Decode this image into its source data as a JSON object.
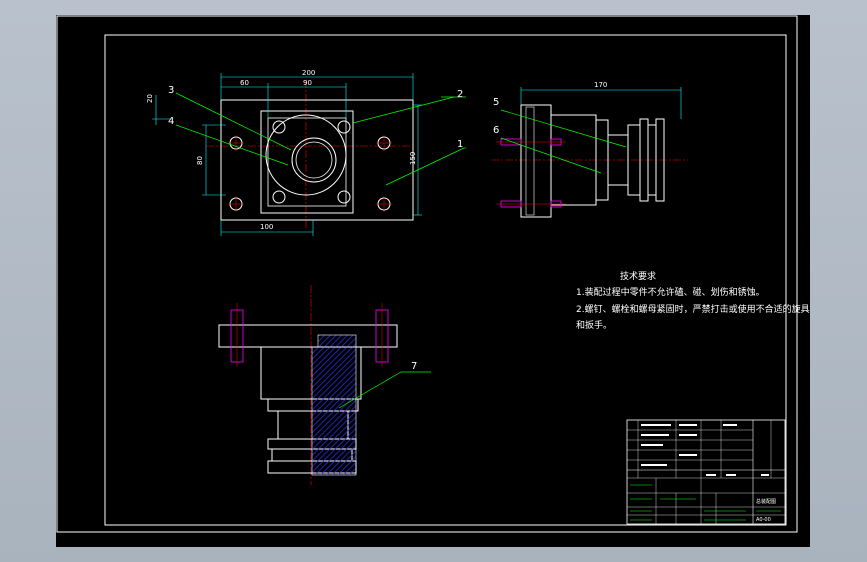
{
  "colors": {
    "background": "#000000",
    "frame": "#ffffff",
    "leader": "#00ff00",
    "centerline": "#ff0000",
    "bolt": "#ff00ff",
    "hatch": "#2b2bd6",
    "cyan": "#00c8c8",
    "dimension": "#00ffff"
  },
  "dimensions": {
    "overall_width": "200",
    "offset_a": "60",
    "offset_b": "90",
    "height_left": "20",
    "height_mid": "80",
    "width_bottom": "100",
    "height_right": "150",
    "side_length": "170"
  },
  "part_labels": [
    "1",
    "2",
    "3",
    "4",
    "5",
    "6",
    "7"
  ],
  "technical_notes": {
    "title": "技术要求",
    "line1": "1.装配过程中零件不允许磕、碰、划伤和锈蚀。",
    "line2": "2.螺钉、螺栓和螺母紧固时，严禁打击或使用不合适的旋具",
    "line3": "和扳手。"
  },
  "title_block": {
    "drawing_name": "总装配图",
    "code": "A0-00"
  }
}
